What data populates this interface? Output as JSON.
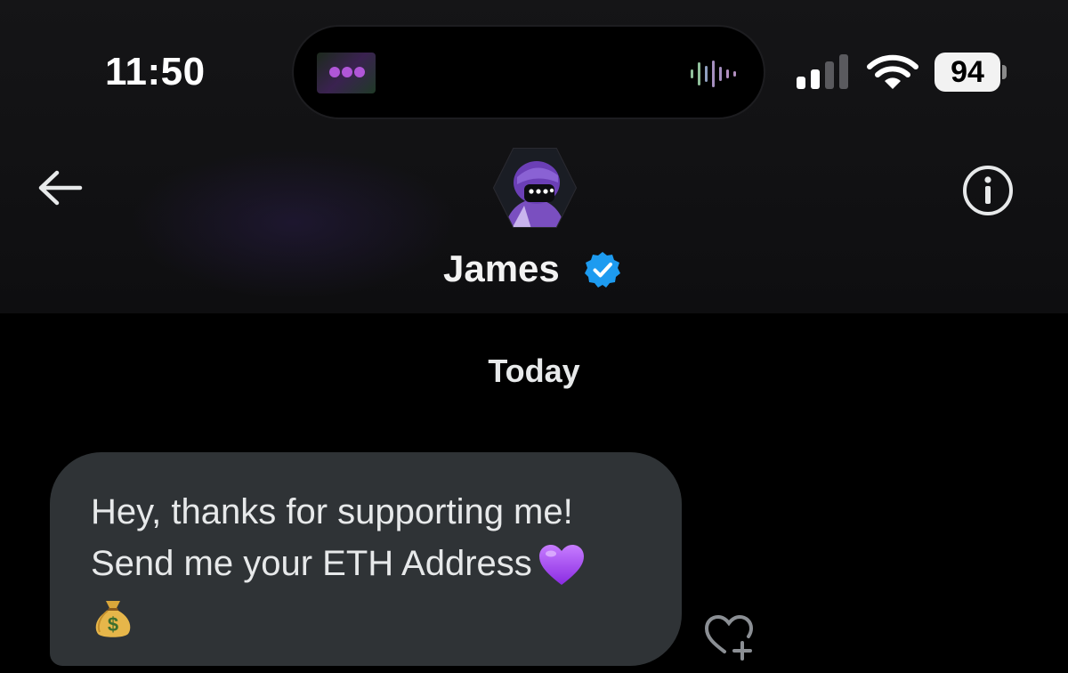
{
  "status_bar": {
    "time": "11:50",
    "battery": "94"
  },
  "conversation_header": {
    "name": "James",
    "verified": true,
    "accent_color": "#1d9bf0"
  },
  "thread": {
    "date_label": "Today",
    "messages": [
      {
        "sender": "James",
        "lines": [
          "Hey, thanks for supporting me!",
          "Send me your ETH Address"
        ],
        "emojis": [
          "purple-heart",
          "money-bag"
        ]
      }
    ]
  },
  "icons": {
    "back": "arrow-left-icon",
    "info": "info-circle-icon",
    "react": "heart-plus-icon"
  },
  "colors": {
    "background": "#000000",
    "bubble": "#2f3336",
    "text": "#e7e9ea"
  }
}
